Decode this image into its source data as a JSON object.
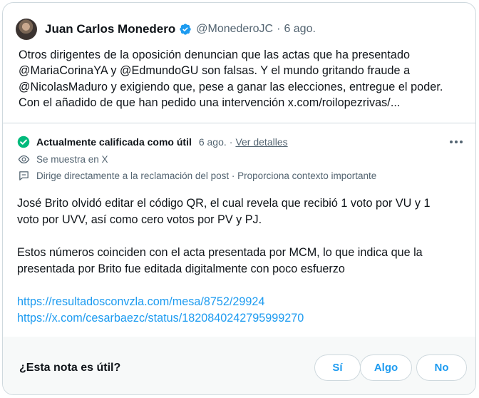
{
  "tweet": {
    "author_name": "Juan Carlos Monedero",
    "handle": "@MonederoJC",
    "separator": "·",
    "date": "6 ago.",
    "lines": [
      "Otros dirigentes de la oposición denuncian que las actas que ha presentado",
      "@MariaCorinaYA y @EdmundoGU son falsas. Y el mundo gritando fraude a",
      "@NicolasMaduro y exigiendo que, pese a ganar las elecciones, entregue el poder.",
      "Con el añadido de que han pedido una intervención x.com/roilopezrivas/..."
    ]
  },
  "note": {
    "status_label": "Actualmente calificada como útil",
    "status_date": "6 ago.",
    "separator": "·",
    "details_link": "Ver detalles",
    "meta_shown": "Se muestra en X",
    "meta_reason": "Dirige directamente a la reclamación del post · Proporciona contexto importante",
    "paragraph1": [
      "José Brito olvidó editar el código QR, el cual revela que recibió 1 voto por VU y 1",
      "voto por UVV, así como cero votos por PV y PJ."
    ],
    "paragraph2": [
      "Estos números coinciden con el acta presentada por MCM, lo que indica que la",
      "presentada por Brito fue editada digitalmente con poco esfuerzo"
    ],
    "links": [
      "https://resultadosconvzla.com/mesa/8752/29924",
      "https://x.com/cesarbaezc/status/1820840242795999270"
    ]
  },
  "footer": {
    "question": "¿Esta nota es útil?",
    "btn_yes": "Sí",
    "btn_some": "Algo",
    "btn_no": "No"
  },
  "colors": {
    "accent": "#1d9bf0",
    "verified": "#1d9bf0",
    "helpful_check": "#00ba7c",
    "secondary_text": "#536471",
    "border": "#cfd9de",
    "footer_bg": "#f7f9f9"
  },
  "icons": {
    "verified": "verified-badge-icon",
    "status": "check-circle-icon",
    "more": "more-dots-icon",
    "shown": "eye-icon",
    "reason": "speech-bubble-icon"
  }
}
